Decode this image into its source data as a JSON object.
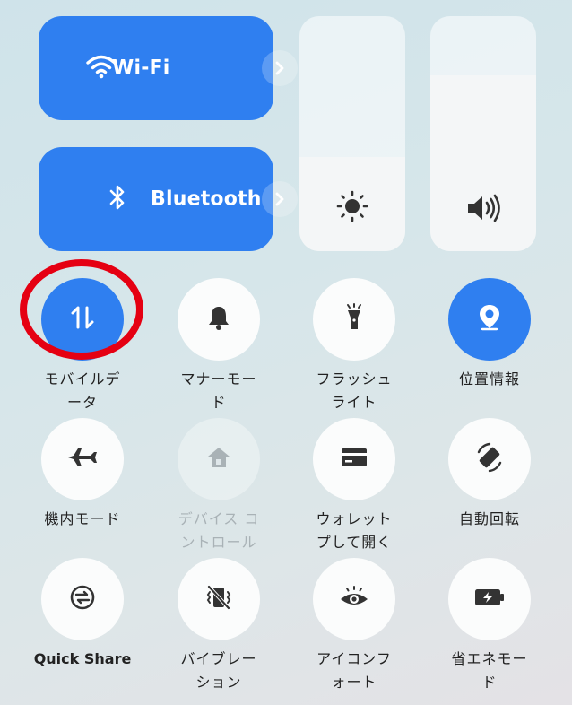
{
  "tiles": {
    "wifi": {
      "label": "Wi-Fi",
      "color": "#2f7ff0"
    },
    "bluetooth": {
      "label": "Bluetooth",
      "color": "#2f7ff0"
    }
  },
  "sliders": {
    "brightness": {
      "icon": "sun-icon",
      "level": 0.4
    },
    "volume": {
      "icon": "speaker-icon",
      "level": 0.75
    }
  },
  "toggles": [
    {
      "label": "モバイルデ\nータ",
      "icon": "mobile-data-icon",
      "state": "on"
    },
    {
      "label": "マナーモー\nド",
      "icon": "bell-icon",
      "state": "off"
    },
    {
      "label": "フラッシュ\nライト",
      "icon": "flashlight-icon",
      "state": "off"
    },
    {
      "label": "位置情報",
      "icon": "location-icon",
      "state": "on"
    },
    {
      "label": "機内モード",
      "icon": "airplane-icon",
      "state": "off"
    },
    {
      "label": "デバイス コ\nントロール",
      "icon": "home-icon",
      "state": "disabled"
    },
    {
      "label": "ウォレット\nプして開く",
      "icon": "wallet-card-icon",
      "state": "off"
    },
    {
      "label": "自動回転",
      "icon": "rotate-icon",
      "state": "off"
    },
    {
      "label": "Quick Share",
      "icon": "quick-share-icon",
      "state": "off"
    },
    {
      "label": "バイブレー\nション",
      "icon": "vibrate-off-icon",
      "state": "off"
    },
    {
      "label": "アイコンフ\nォート",
      "icon": "eye-icon",
      "state": "off"
    },
    {
      "label": "省エネモー\nド",
      "icon": "battery-saver-icon",
      "state": "off"
    }
  ],
  "highlight": {
    "color": "#e50012",
    "target": "モバイルデータ"
  }
}
